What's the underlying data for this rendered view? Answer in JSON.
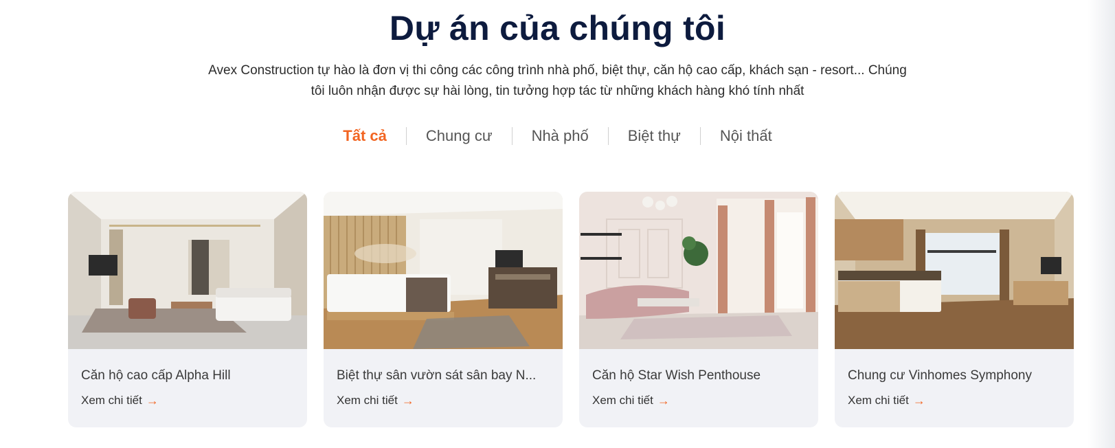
{
  "section": {
    "title": "Dự án của chúng tôi",
    "intro_line1": "Avex Construction tự hào là đơn vị thi công các công trình nhà phố, biệt thự, căn hộ cao cấp, khách sạn - resort... Chúng",
    "intro_line2": "tôi luôn nhận được sự hài lòng, tin tưởng hợp tác từ những khách hàng khó tính nhất"
  },
  "tabs": [
    {
      "label": "Tất cả",
      "active": true
    },
    {
      "label": "Chung cư",
      "active": false
    },
    {
      "label": "Nhà phố",
      "active": false
    },
    {
      "label": "Biệt thự",
      "active": false
    },
    {
      "label": "Nội thất",
      "active": false
    }
  ],
  "cards": [
    {
      "title": "Căn hộ cao cấp Alpha Hill",
      "link_label": "Xem chi tiết",
      "arrow": "→"
    },
    {
      "title": "Biệt thự sân vườn sát sân bay N...",
      "link_label": "Xem chi tiết",
      "arrow": "→"
    },
    {
      "title": "Căn hộ Star Wish Penthouse",
      "link_label": "Xem chi tiết",
      "arrow": "→"
    },
    {
      "title": "Chung cư Vinhomes Symphony",
      "link_label": "Xem chi tiết",
      "arrow": "→"
    }
  ],
  "colors": {
    "accent": "#f26522",
    "heading": "#0d1b3e",
    "card_bg": "#f1f2f6"
  }
}
